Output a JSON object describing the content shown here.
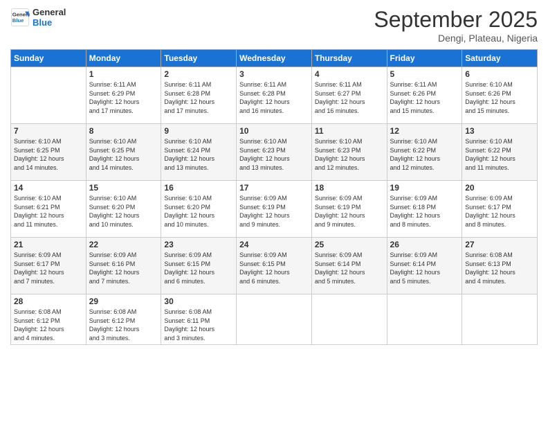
{
  "logo": {
    "line1": "General",
    "line2": "Blue"
  },
  "title": "September 2025",
  "subtitle": "Dengi, Plateau, Nigeria",
  "days_header": [
    "Sunday",
    "Monday",
    "Tuesday",
    "Wednesday",
    "Thursday",
    "Friday",
    "Saturday"
  ],
  "weeks": [
    [
      {
        "num": "",
        "info": ""
      },
      {
        "num": "1",
        "info": "Sunrise: 6:11 AM\nSunset: 6:29 PM\nDaylight: 12 hours\nand 17 minutes."
      },
      {
        "num": "2",
        "info": "Sunrise: 6:11 AM\nSunset: 6:28 PM\nDaylight: 12 hours\nand 17 minutes."
      },
      {
        "num": "3",
        "info": "Sunrise: 6:11 AM\nSunset: 6:28 PM\nDaylight: 12 hours\nand 16 minutes."
      },
      {
        "num": "4",
        "info": "Sunrise: 6:11 AM\nSunset: 6:27 PM\nDaylight: 12 hours\nand 16 minutes."
      },
      {
        "num": "5",
        "info": "Sunrise: 6:11 AM\nSunset: 6:26 PM\nDaylight: 12 hours\nand 15 minutes."
      },
      {
        "num": "6",
        "info": "Sunrise: 6:10 AM\nSunset: 6:26 PM\nDaylight: 12 hours\nand 15 minutes."
      }
    ],
    [
      {
        "num": "7",
        "info": "Sunrise: 6:10 AM\nSunset: 6:25 PM\nDaylight: 12 hours\nand 14 minutes."
      },
      {
        "num": "8",
        "info": "Sunrise: 6:10 AM\nSunset: 6:25 PM\nDaylight: 12 hours\nand 14 minutes."
      },
      {
        "num": "9",
        "info": "Sunrise: 6:10 AM\nSunset: 6:24 PM\nDaylight: 12 hours\nand 13 minutes."
      },
      {
        "num": "10",
        "info": "Sunrise: 6:10 AM\nSunset: 6:23 PM\nDaylight: 12 hours\nand 13 minutes."
      },
      {
        "num": "11",
        "info": "Sunrise: 6:10 AM\nSunset: 6:23 PM\nDaylight: 12 hours\nand 12 minutes."
      },
      {
        "num": "12",
        "info": "Sunrise: 6:10 AM\nSunset: 6:22 PM\nDaylight: 12 hours\nand 12 minutes."
      },
      {
        "num": "13",
        "info": "Sunrise: 6:10 AM\nSunset: 6:22 PM\nDaylight: 12 hours\nand 11 minutes."
      }
    ],
    [
      {
        "num": "14",
        "info": "Sunrise: 6:10 AM\nSunset: 6:21 PM\nDaylight: 12 hours\nand 11 minutes."
      },
      {
        "num": "15",
        "info": "Sunrise: 6:10 AM\nSunset: 6:20 PM\nDaylight: 12 hours\nand 10 minutes."
      },
      {
        "num": "16",
        "info": "Sunrise: 6:10 AM\nSunset: 6:20 PM\nDaylight: 12 hours\nand 10 minutes."
      },
      {
        "num": "17",
        "info": "Sunrise: 6:09 AM\nSunset: 6:19 PM\nDaylight: 12 hours\nand 9 minutes."
      },
      {
        "num": "18",
        "info": "Sunrise: 6:09 AM\nSunset: 6:19 PM\nDaylight: 12 hours\nand 9 minutes."
      },
      {
        "num": "19",
        "info": "Sunrise: 6:09 AM\nSunset: 6:18 PM\nDaylight: 12 hours\nand 8 minutes."
      },
      {
        "num": "20",
        "info": "Sunrise: 6:09 AM\nSunset: 6:17 PM\nDaylight: 12 hours\nand 8 minutes."
      }
    ],
    [
      {
        "num": "21",
        "info": "Sunrise: 6:09 AM\nSunset: 6:17 PM\nDaylight: 12 hours\nand 7 minutes."
      },
      {
        "num": "22",
        "info": "Sunrise: 6:09 AM\nSunset: 6:16 PM\nDaylight: 12 hours\nand 7 minutes."
      },
      {
        "num": "23",
        "info": "Sunrise: 6:09 AM\nSunset: 6:15 PM\nDaylight: 12 hours\nand 6 minutes."
      },
      {
        "num": "24",
        "info": "Sunrise: 6:09 AM\nSunset: 6:15 PM\nDaylight: 12 hours\nand 6 minutes."
      },
      {
        "num": "25",
        "info": "Sunrise: 6:09 AM\nSunset: 6:14 PM\nDaylight: 12 hours\nand 5 minutes."
      },
      {
        "num": "26",
        "info": "Sunrise: 6:09 AM\nSunset: 6:14 PM\nDaylight: 12 hours\nand 5 minutes."
      },
      {
        "num": "27",
        "info": "Sunrise: 6:08 AM\nSunset: 6:13 PM\nDaylight: 12 hours\nand 4 minutes."
      }
    ],
    [
      {
        "num": "28",
        "info": "Sunrise: 6:08 AM\nSunset: 6:12 PM\nDaylight: 12 hours\nand 4 minutes."
      },
      {
        "num": "29",
        "info": "Sunrise: 6:08 AM\nSunset: 6:12 PM\nDaylight: 12 hours\nand 3 minutes."
      },
      {
        "num": "30",
        "info": "Sunrise: 6:08 AM\nSunset: 6:11 PM\nDaylight: 12 hours\nand 3 minutes."
      },
      {
        "num": "",
        "info": ""
      },
      {
        "num": "",
        "info": ""
      },
      {
        "num": "",
        "info": ""
      },
      {
        "num": "",
        "info": ""
      }
    ]
  ]
}
